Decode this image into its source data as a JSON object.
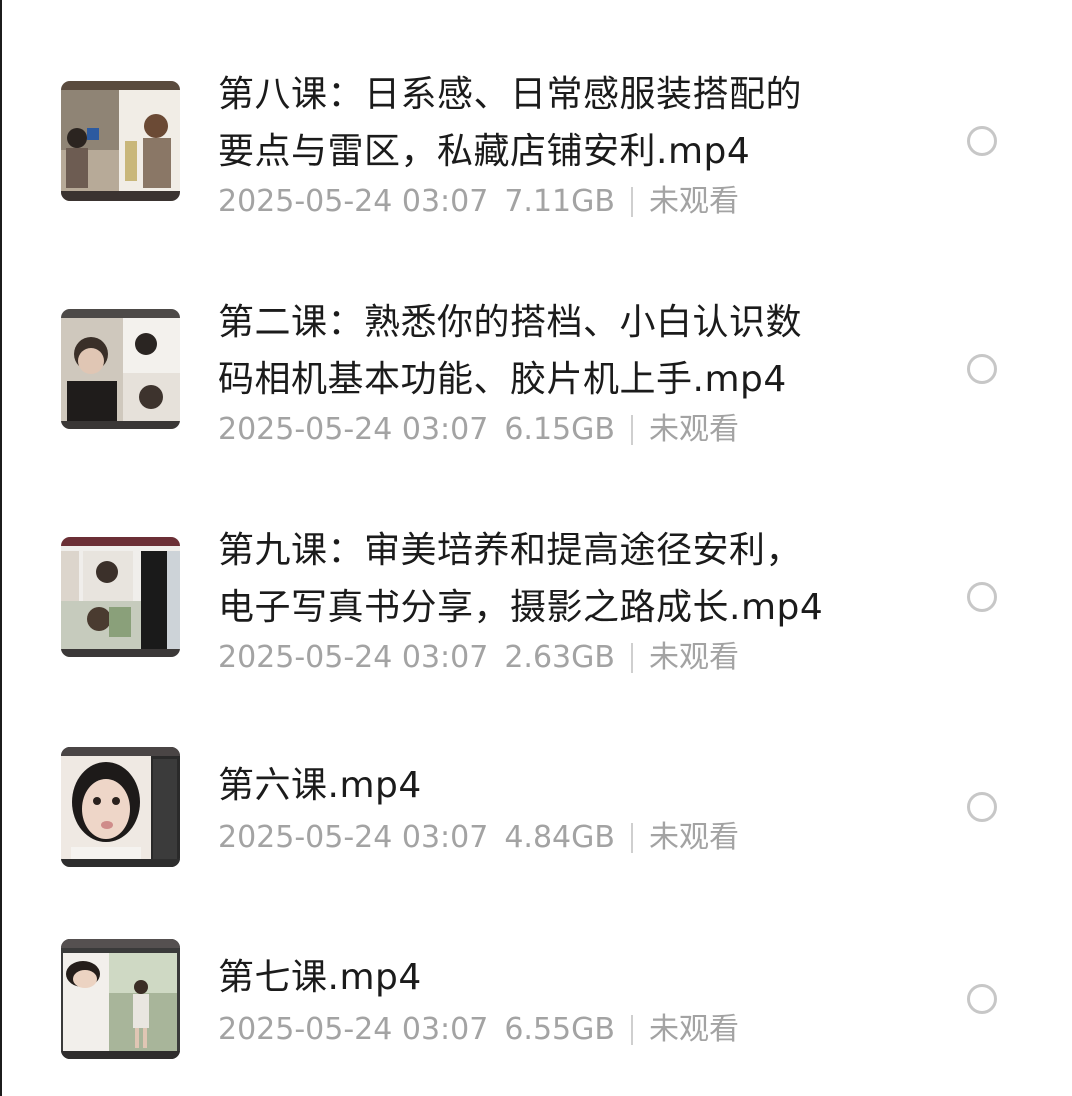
{
  "files": [
    {
      "title_line1": "第八课：日系感、日常感服装搭配的",
      "title_line2": "要点与雷区，私藏店铺安利.mp4",
      "date": "2025-05-24 03:07",
      "size": "7.11GB",
      "status": "未观看",
      "selected": false
    },
    {
      "title_line1": "第二课：熟悉你的搭档、小白认识数",
      "title_line2": "码相机基本功能、胶片机上手.mp4",
      "date": "2025-05-24 03:07",
      "size": "6.15GB",
      "status": "未观看",
      "selected": false
    },
    {
      "title_line1": "第九课：审美培养和提高途径安利，",
      "title_line2": "电子写真书分享，摄影之路成长.mp4",
      "date": "2025-05-24 03:07",
      "size": "2.63GB",
      "status": "未观看",
      "selected": false
    },
    {
      "title_line1": "第六课.mp4",
      "date": "2025-05-24 03:07",
      "size": "4.84GB",
      "status": "未观看",
      "selected": false
    },
    {
      "title_line1": "第七课.mp4",
      "date": "2025-05-24 03:07",
      "size": "6.55GB",
      "status": "未观看",
      "selected": false
    }
  ],
  "icons": {
    "thumbnail": "video-thumbnail",
    "select": "radio-unchecked-icon"
  },
  "colors": {
    "title": "#1b1b1b",
    "meta": "#a3a3a3",
    "radio_border": "#c7c7c7"
  }
}
